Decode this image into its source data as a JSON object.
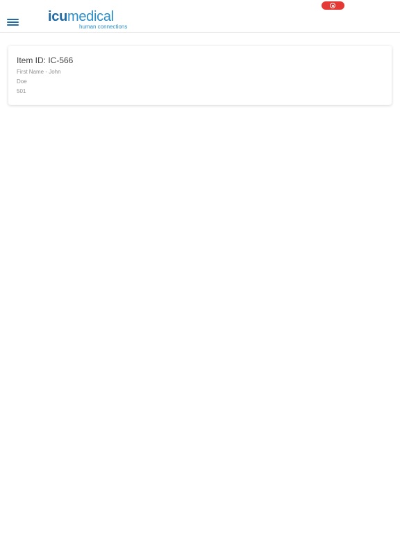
{
  "header": {
    "logo": {
      "bold_part": "icu",
      "light_part": "medical",
      "tagline": "human connections"
    },
    "record_toggle": {
      "state": "on",
      "color": "#e53935"
    },
    "menu_icon": "hamburger-icon"
  },
  "colors": {
    "brand_dark": "#1f6aa5",
    "brand_light": "#2b8ec8",
    "record": "#e53935"
  },
  "items": [
    {
      "title": "Item ID: IC-566",
      "first_name": "First Name - John",
      "last_name": "Doe",
      "number": "501"
    }
  ]
}
